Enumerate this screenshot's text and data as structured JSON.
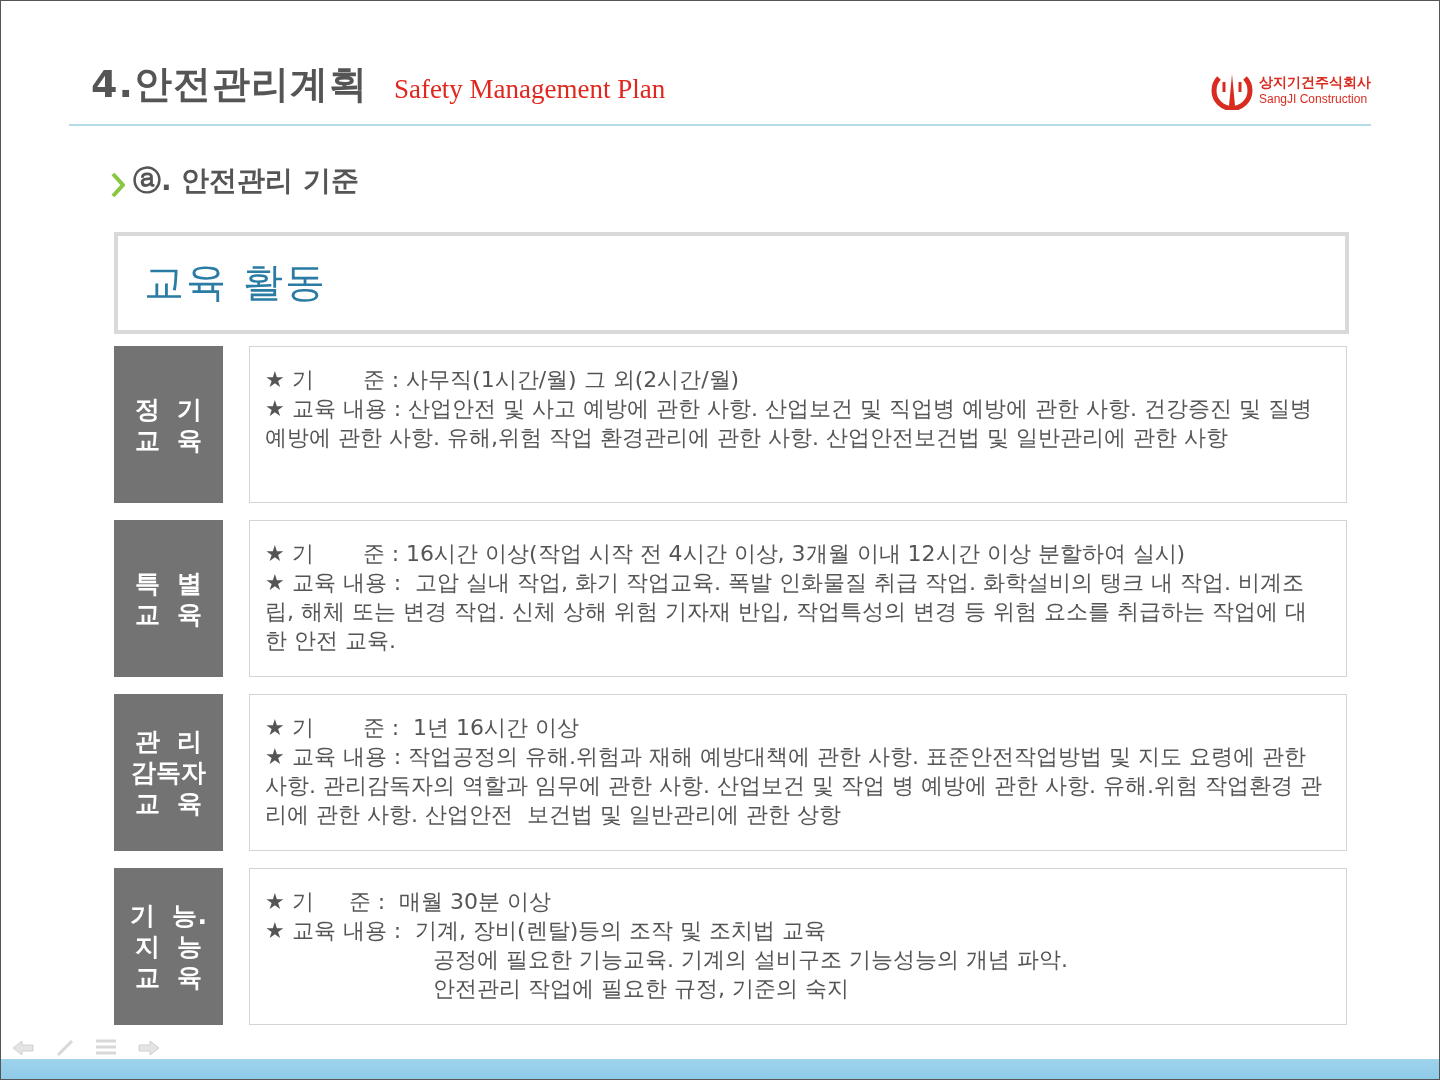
{
  "header": {
    "title": "4.안전관리계획",
    "subtitle": "Safety Management Plan",
    "logo": {
      "name": "상지기건주식회사",
      "english": "SangJI Construction"
    }
  },
  "section_heading": "ⓐ. 안전관리 기준",
  "panel_title": "교육 활동",
  "sections": [
    {
      "label": [
        "정  기",
        "교  육"
      ],
      "lines": [
        {
          "kind": "bullet",
          "text": "★ 기       준 : 사무직(1시간/월) 그 외(2시간/월)"
        },
        {
          "kind": "bullet",
          "text": "★ 교육 내용 : 산업안전 및 사고 예방에 관한 사항. 산업보건 및 직업병 예방에 관한 사항. 건강증진 및 질병 예방에 관한 사항. 유해,위험 작업 환경관리에 관한 사항. 산업안전보건법 및 일반관리에 관한 사항"
        }
      ]
    },
    {
      "label": [
        "특  별",
        "교  육"
      ],
      "lines": [
        {
          "kind": "bullet",
          "text": "★ 기       준 : 16시간 이상(작업 시작 전 4시간 이상, 3개월 이내 12시간 이상 분할하여 실시)"
        },
        {
          "kind": "bullet",
          "text": "★ 교육 내용 :  고압 실내 작업, 화기 작업교육. 폭발 인화물질 취급 작업. 화학설비의 탱크 내 작업. 비계조립, 해체 또는 변경 작업. 신체 상해 위험 기자재 반입, 작업특성의 변경 등 위험 요소를 취급하는 작업에 대한 안전 교육."
        }
      ]
    },
    {
      "label": [
        "관  리",
        "감독자",
        "교  육"
      ],
      "lines": [
        {
          "kind": "bullet",
          "text": "★ 기       준 :  1년 16시간 이상"
        },
        {
          "kind": "bullet",
          "text": "★ 교육 내용 : 작업공정의 유해.위험과 재해 예방대책에 관한 사항. 표준안전작업방법 및 지도 요령에 관한 사항. 관리감독자의 역할과 임무에 관한 사항. 산업보건 및 작업 병 예방에 관한 사항. 유해.위험 작업환경 관리에 관한 사항. 산업안전  보건법 및 일반관리에 관한 상항"
        }
      ]
    },
    {
      "label": [
        "기  능.",
        "지  능",
        "교  육"
      ],
      "lines": [
        {
          "kind": "bullet",
          "text": "★ 기     준 :  매월 30분 이상"
        },
        {
          "kind": "bullet",
          "text": "★ 교육 내용 :  기계, 장비(렌탈)등의 조작 및 조치법 교육"
        },
        {
          "kind": "indent",
          "text": "공정에 필요한 기능교육. 기계의 설비구조 기능성능의 개념 파악."
        },
        {
          "kind": "indent",
          "text": "안전관리 작업에 필요한 규정, 기준의 숙지"
        }
      ]
    }
  ]
}
